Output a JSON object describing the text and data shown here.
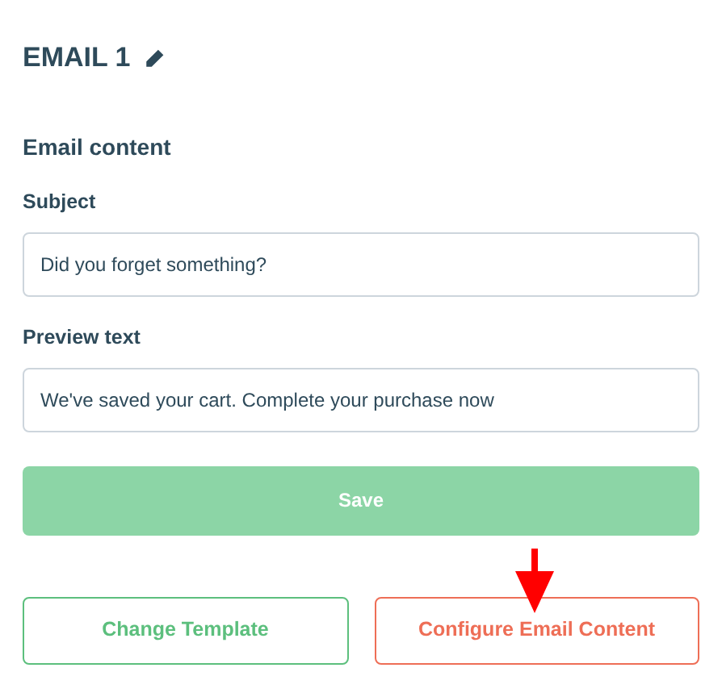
{
  "title": "EMAIL 1",
  "section_title": "Email content",
  "fields": [
    {
      "label": "Subject",
      "value": "Did you forget something?"
    },
    {
      "label": "Preview text",
      "value": "We've saved your cart. Complete your purchase now"
    }
  ],
  "save_button": {
    "label": "Save",
    "disabled": true
  },
  "actions": [
    {
      "label": "Change Template",
      "color": "#5cbf7d"
    },
    {
      "label": "Configure Email Content",
      "color": "#ee6e56"
    }
  ]
}
